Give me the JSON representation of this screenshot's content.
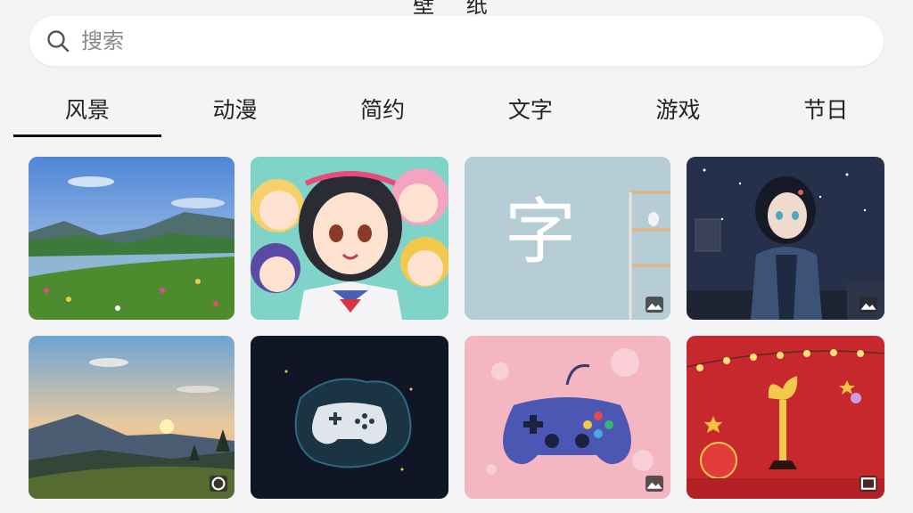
{
  "header": {
    "title_partial": "壁 纸"
  },
  "search": {
    "placeholder": "搜索",
    "icon": "search-icon"
  },
  "tabs": [
    {
      "label": "风景",
      "active": true
    },
    {
      "label": "动漫",
      "active": false
    },
    {
      "label": "简约",
      "active": false
    },
    {
      "label": "文字",
      "active": false
    },
    {
      "label": "游戏",
      "active": false
    },
    {
      "label": "节日",
      "active": false
    }
  ],
  "wallpapers": [
    {
      "subject": "mountain lake landscape",
      "badge": false
    },
    {
      "subject": "anime girls group",
      "badge": false
    },
    {
      "subject": "minimal room with character",
      "glyph": "字",
      "badge": true
    },
    {
      "subject": "anime girl in hoodie at night",
      "badge": true
    },
    {
      "subject": "mountain sunset",
      "badge": true
    },
    {
      "subject": "glowing game controller",
      "badge": false
    },
    {
      "subject": "blue game controller on pink",
      "badge": true
    },
    {
      "subject": "festive gift with lights",
      "badge": true
    }
  ],
  "colors": {
    "accent": "#111111",
    "background": "#f4f4f6"
  }
}
